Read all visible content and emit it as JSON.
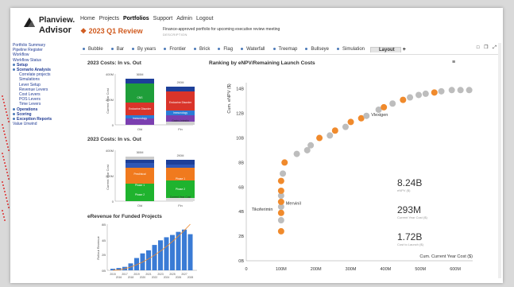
{
  "app": {
    "brand_line1": "Planview.",
    "brand_line2": "Advisor"
  },
  "topnav": [
    "Home",
    "Projects",
    "Portfolios",
    "Support",
    "Admin",
    "Logout"
  ],
  "topnav_active": "Portfolios",
  "page": {
    "title": "2023 Q1 Review",
    "description": "Finance-approved portfolio for upcoming executive review meeting",
    "description_label": "DESCRIPTION"
  },
  "tabs": [
    "Bubble",
    "Bar",
    "By years",
    "Frontier",
    "Brick",
    "Flag",
    "Waterfall",
    "Treemap",
    "Bullseye",
    "Simulation",
    "Layout"
  ],
  "tab_selected": "Layout",
  "tab_add": "+",
  "sidebar": [
    {
      "label": "Portfolio Summary",
      "type": "item"
    },
    {
      "label": "Pipeline Register",
      "type": "item"
    },
    {
      "label": "Workflow",
      "type": "item"
    },
    {
      "label": "Workflow Status",
      "type": "item"
    },
    {
      "label": "Setup",
      "type": "hdr"
    },
    {
      "label": "Scenario Analysis",
      "type": "hdr"
    },
    {
      "label": "Correlate projects",
      "type": "ind"
    },
    {
      "label": "Simulations",
      "type": "ind"
    },
    {
      "label": "Lever Setup",
      "type": "ind"
    },
    {
      "label": "Revenue Levers",
      "type": "ind"
    },
    {
      "label": "Cost Levers",
      "type": "ind"
    },
    {
      "label": "POS Levers",
      "type": "ind"
    },
    {
      "label": "Time Levers",
      "type": "ind"
    },
    {
      "label": "Operations",
      "type": "hdr"
    },
    {
      "label": "Scoring",
      "type": "hdr"
    },
    {
      "label": "Exception Reports",
      "type": "hdr"
    },
    {
      "label": "Value Unwind",
      "type": "item"
    }
  ],
  "panel1": {
    "title": "2023 Costs: In vs. Out",
    "ylabel": "Current Year Cost",
    "cats": [
      "Old",
      "Fin"
    ],
    "top_labels": [
      "365M",
      "290M"
    ],
    "seg_labels": [
      "CNS",
      "Endocrine Disorder",
      "Immunology",
      "Endocrine Disorder",
      "Immunology",
      "Gastro-Intestin"
    ],
    "yticks": [
      "400M",
      "200M",
      "0"
    ]
  },
  "panel2": {
    "title": "2023 Costs: In vs. Out",
    "ylabel": "Current Year Cost",
    "cats": [
      "Old",
      "Fin"
    ],
    "top_labels": [
      "365M",
      "290M"
    ],
    "seg_labels": [
      "Preclinical",
      "Phase 1",
      "Phase 2",
      "Phase 1",
      "Phase 2",
      "Current Year Cost"
    ],
    "yticks": [
      "400M",
      "200M",
      "0"
    ]
  },
  "panel3": {
    "title": "eRevenue for Funded Projects",
    "ylabel": "Rollout Revenue",
    "yticks": [
      "8B",
      "4B",
      "2B",
      "0B"
    ],
    "years": [
      "2015",
      "2016",
      "2017",
      "2018",
      "2019",
      "2020",
      "2021",
      "2022",
      "2023",
      "2024",
      "2025",
      "2026",
      "2027",
      "2028"
    ]
  },
  "main": {
    "title": "Ranking by eNPV/Remaining Launch Costs",
    "menu": "≡"
  },
  "stats": [
    {
      "value": "8.24B",
      "label": "eNPV ($)"
    },
    {
      "value": "293M",
      "label": "Current Year Cost ($)"
    },
    {
      "value": "1.72B",
      "label": "Cost to Launch ($)"
    }
  ],
  "chart_data": {
    "type": "scatter",
    "xlabel": "Cum. Current Year Cost ($)",
    "ylabel": "Cum. eNPV ($)",
    "xlim": [
      0,
      650
    ],
    "ylim": [
      0,
      14.5
    ],
    "x_ticks": [
      "0",
      "100M",
      "200M",
      "300M",
      "400M",
      "500M",
      "600M"
    ],
    "y_ticks": [
      "0B",
      "2B",
      "4B",
      "6B",
      "8B",
      "10B",
      "12B",
      "14B"
    ],
    "annotations": [
      {
        "text": "Vlexigen",
        "x": 345,
        "y": 11.9
      },
      {
        "text": "Mervinil",
        "x": 100,
        "y": 4.7
      },
      {
        "text": "Tikoferimin",
        "x": 90,
        "y": 4.2
      }
    ],
    "points": [
      {
        "x": 100,
        "y": 2.4,
        "c": "o"
      },
      {
        "x": 100,
        "y": 3.3,
        "c": "g"
      },
      {
        "x": 100,
        "y": 3.9,
        "c": "o"
      },
      {
        "x": 100,
        "y": 4.4,
        "c": "g"
      },
      {
        "x": 100,
        "y": 4.8,
        "c": "o"
      },
      {
        "x": 100,
        "y": 5.3,
        "c": "g"
      },
      {
        "x": 100,
        "y": 5.7,
        "c": "o"
      },
      {
        "x": 100,
        "y": 6.5,
        "c": "o"
      },
      {
        "x": 105,
        "y": 7.1,
        "c": "g"
      },
      {
        "x": 110,
        "y": 8.0,
        "c": "o"
      },
      {
        "x": 145,
        "y": 8.7,
        "c": "g"
      },
      {
        "x": 175,
        "y": 9.0,
        "c": "g"
      },
      {
        "x": 185,
        "y": 9.4,
        "c": "g"
      },
      {
        "x": 210,
        "y": 10.0,
        "c": "o"
      },
      {
        "x": 240,
        "y": 10.2,
        "c": "g"
      },
      {
        "x": 255,
        "y": 10.6,
        "c": "o"
      },
      {
        "x": 285,
        "y": 10.9,
        "c": "g"
      },
      {
        "x": 300,
        "y": 11.3,
        "c": "o"
      },
      {
        "x": 330,
        "y": 11.6,
        "c": "o"
      },
      {
        "x": 345,
        "y": 11.8,
        "c": "g"
      },
      {
        "x": 380,
        "y": 12.3,
        "c": "g"
      },
      {
        "x": 395,
        "y": 12.5,
        "c": "o"
      },
      {
        "x": 420,
        "y": 12.8,
        "c": "g"
      },
      {
        "x": 450,
        "y": 13.1,
        "c": "o"
      },
      {
        "x": 470,
        "y": 13.3,
        "c": "g"
      },
      {
        "x": 495,
        "y": 13.5,
        "c": "g"
      },
      {
        "x": 515,
        "y": 13.6,
        "c": "g"
      },
      {
        "x": 540,
        "y": 13.7,
        "c": "o"
      },
      {
        "x": 560,
        "y": 13.8,
        "c": "g"
      },
      {
        "x": 590,
        "y": 13.9,
        "c": "g"
      },
      {
        "x": 615,
        "y": 13.9,
        "c": "g"
      },
      {
        "x": 640,
        "y": 13.9,
        "c": "g"
      }
    ],
    "colors": {
      "o": "#f08a2c",
      "g": "#bdbdbd"
    }
  },
  "bars3": [
    0.2,
    0.3,
    0.45,
    0.9,
    1.6,
    2.2,
    2.6,
    3.3,
    3.9,
    4.3,
    4.6,
    5.0,
    5.3,
    4.7
  ],
  "colors": {
    "accent": "#d05a1e",
    "nav": "#1f3a93"
  }
}
